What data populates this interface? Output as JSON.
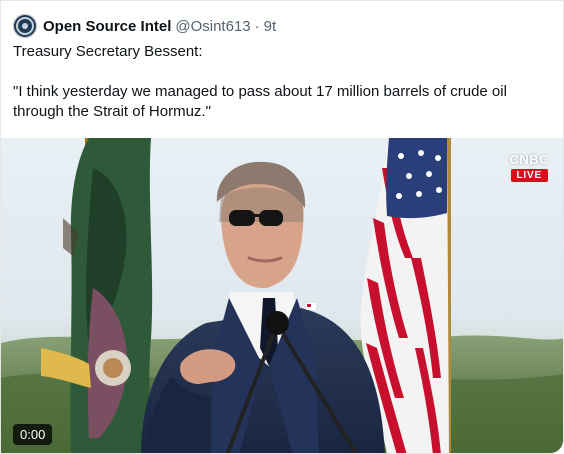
{
  "post": {
    "author_name": "Open Source Intel",
    "handle": "@Osint613",
    "separator": "·",
    "time": "9t",
    "text_line1": "Treasury Secretary Bessent:",
    "text_quote_line1": "\"I think yesterday we managed to pass about 17 million barrels of crude oil",
    "text_quote_line2": "through the Strait of Hormuz.\""
  },
  "media": {
    "network": "CNBC",
    "live_label": "LIVE",
    "duration": "0:00"
  },
  "colors": {
    "text": "#0f1419",
    "muted": "#536471",
    "live_red": "#d60f1c"
  }
}
